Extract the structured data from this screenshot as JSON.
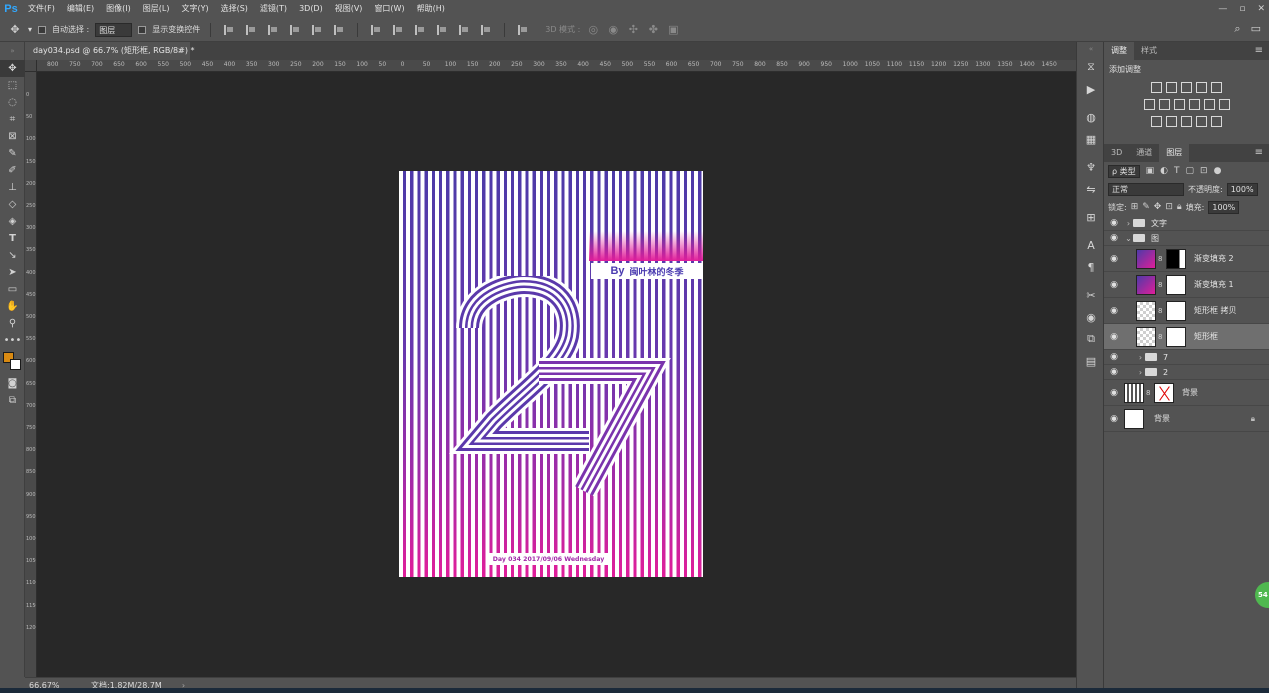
{
  "app": {
    "logo": "Ps",
    "menu": [
      "文件(F)",
      "编辑(E)",
      "图像(I)",
      "图层(L)",
      "文字(Y)",
      "选择(S)",
      "滤镜(T)",
      "3D(D)",
      "视图(V)",
      "窗口(W)",
      "帮助(H)"
    ],
    "window_controls": [
      "—",
      "▫",
      "✕"
    ]
  },
  "options": {
    "auto_select_label": "自动选择 :",
    "auto_select_value": "图层",
    "show_transform_label": "显示变换控件",
    "mode_3d_label": "3D 模式 :"
  },
  "document": {
    "tab_title": "day034.psd @ 66.7% (矩形框, RGB/8#) *",
    "tab_close": "×"
  },
  "ruler": {
    "h_labels": [
      "800",
      "750",
      "700",
      "650",
      "600",
      "550",
      "500",
      "450",
      "400",
      "350",
      "300",
      "250",
      "200",
      "150",
      "100",
      "50",
      "0",
      "50",
      "100",
      "150",
      "200",
      "250",
      "300",
      "350",
      "400",
      "450",
      "500",
      "550",
      "600",
      "650",
      "700",
      "750",
      "800",
      "850",
      "900",
      "950",
      "1000",
      "1050",
      "1100",
      "1150",
      "1200",
      "1250",
      "1300",
      "1350",
      "1400",
      "1450"
    ],
    "v_labels": [
      "0",
      "50",
      "100",
      "150",
      "200",
      "250",
      "300",
      "350",
      "400",
      "450",
      "500",
      "550",
      "600",
      "650",
      "700",
      "750",
      "800",
      "850",
      "900",
      "950",
      "1000",
      "1050",
      "1100",
      "1150",
      "1200"
    ]
  },
  "poster": {
    "author_by": "By",
    "author_name": "闽叶林的冬季",
    "footer": "Day 034  2017/09/06  Wednesday"
  },
  "status": {
    "zoom": "66.67%",
    "doc_info": "文档:1.82M/28.7M",
    "arrow": "›"
  },
  "panels": {
    "top_tabs": [
      "调整",
      "样式"
    ],
    "adj_title": "添加调整",
    "layer_tabs": [
      "3D",
      "通道",
      "图层"
    ],
    "filter_kind": "ρ 类型",
    "blend_mode": "正常",
    "opacity_label": "不透明度:",
    "opacity_value": "100%",
    "lock_label": "锁定:",
    "fill_label": "填充:",
    "fill_value": "100%",
    "layers": [
      {
        "name": "文字",
        "type": "group"
      },
      {
        "name": "图",
        "type": "group-open"
      },
      {
        "name": "渐变填充 2",
        "type": "grad"
      },
      {
        "name": "渐变填充 1",
        "type": "grad"
      },
      {
        "name": "矩形框 拷贝",
        "type": "shape"
      },
      {
        "name": "矩形框",
        "type": "shape-selected"
      },
      {
        "name": "7",
        "type": "subgroup"
      },
      {
        "name": "2",
        "type": "subgroup"
      },
      {
        "name": "背景",
        "type": "x"
      },
      {
        "name": "背景",
        "type": "bg"
      }
    ]
  },
  "badge": "54",
  "colors": {
    "foreground": "#d98a12",
    "background": "#ffffff",
    "poster_purple": "#4d3aa8",
    "poster_pink": "#e01e9a"
  }
}
